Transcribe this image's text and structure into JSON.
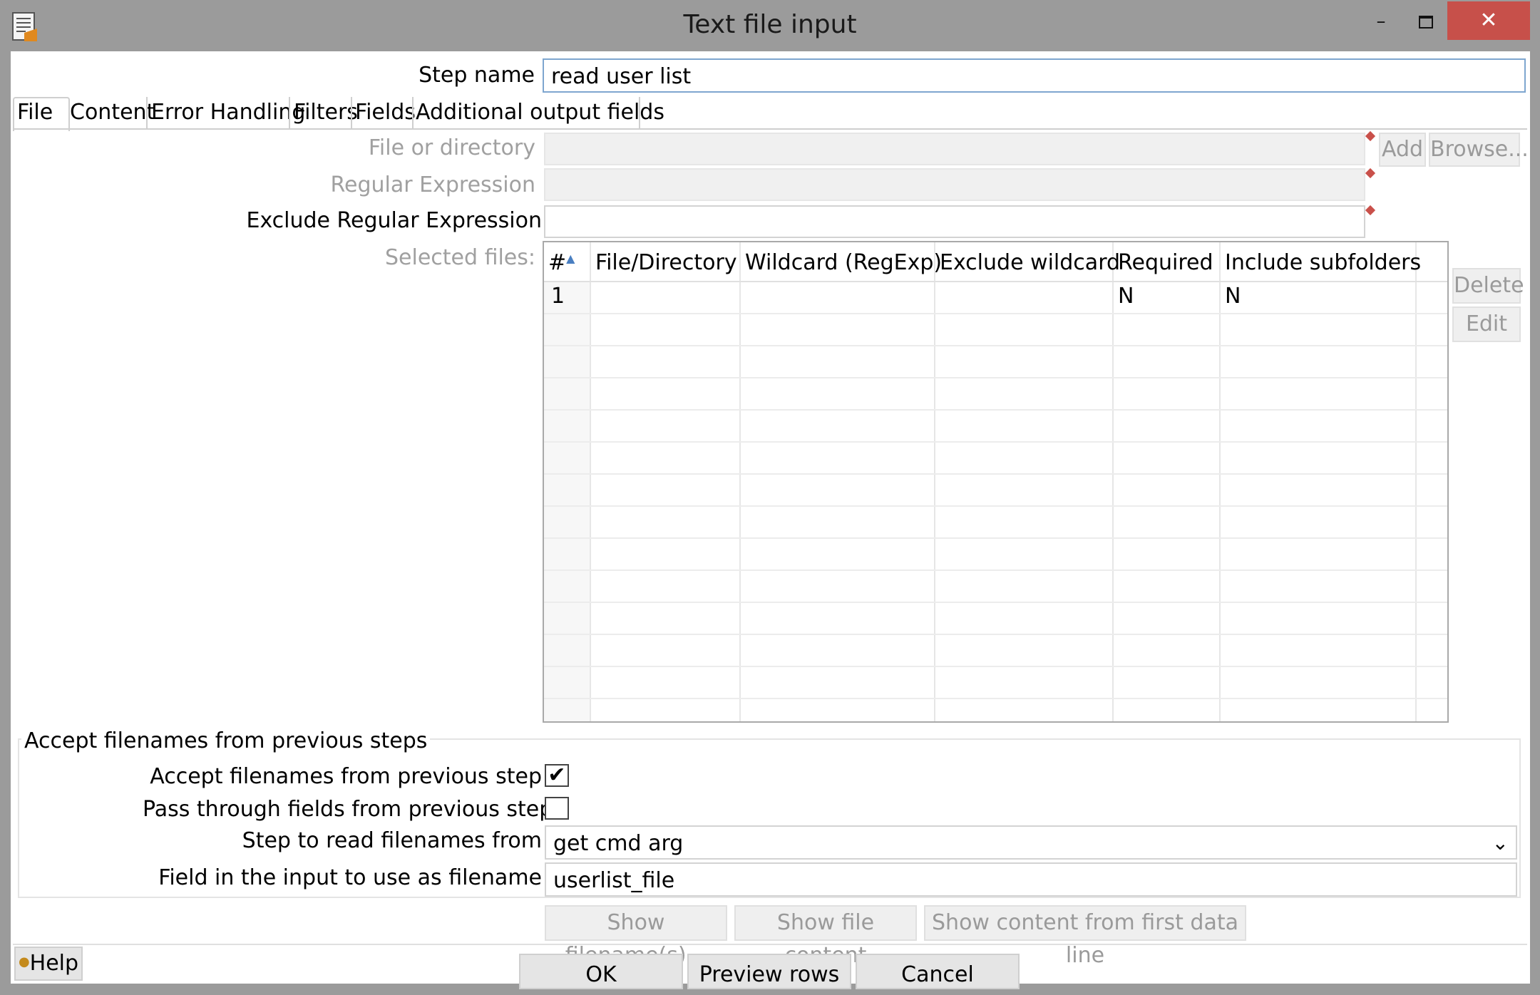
{
  "window": {
    "title": "Text file input",
    "minimize_label": "–",
    "close_label": "✕",
    "app_icon": "text-file-icon",
    "colors": {
      "frame": "#9b9b9b",
      "close": "#c7504a"
    }
  },
  "step_name": {
    "label": "Step name",
    "value": "read user list"
  },
  "tabs": [
    {
      "label": "File",
      "active": true
    },
    {
      "label": "Content"
    },
    {
      "label": "Error Handling"
    },
    {
      "label": "Filters"
    },
    {
      "label": "Fields"
    },
    {
      "label": "Additional output fields"
    }
  ],
  "file_tab": {
    "file_or_directory": {
      "label": "File or directory",
      "value": ""
    },
    "regular_expression": {
      "label": "Regular Expression",
      "value": ""
    },
    "exclude_regular_expression": {
      "label": "Exclude Regular Expression",
      "value": ""
    },
    "add_button": "Add",
    "browse_button": "Browse...",
    "selected_files_label": "Selected files:",
    "table": {
      "columns": [
        "#",
        "File/Directory",
        "Wildcard (RegExp)",
        "Exclude wildcard",
        "Required",
        "Include subfolders"
      ],
      "rows": [
        {
          "num": "1",
          "file": "",
          "wildcard": "",
          "exclude": "",
          "required": "N",
          "subfolders": "N"
        }
      ]
    },
    "delete_button": "Delete",
    "edit_button": "Edit",
    "accept_group": {
      "title": "Accept filenames from previous steps",
      "accept_label": "Accept filenames from previous step",
      "accept_checked": true,
      "pass_through_label": "Pass through fields from previous step",
      "pass_through_checked": false,
      "step_label": "Step to read filenames from",
      "step_value": "get cmd arg",
      "field_label": "Field in the input to use as filename",
      "field_value": "userlist_file"
    },
    "show_filenames_button": "Show filename(s)...",
    "show_file_content_button": "Show file content",
    "show_content_first_line_button": "Show content from first data line"
  },
  "footer": {
    "help_button": "Help",
    "ok_button": "OK",
    "preview_button": "Preview rows",
    "cancel_button": "Cancel"
  }
}
